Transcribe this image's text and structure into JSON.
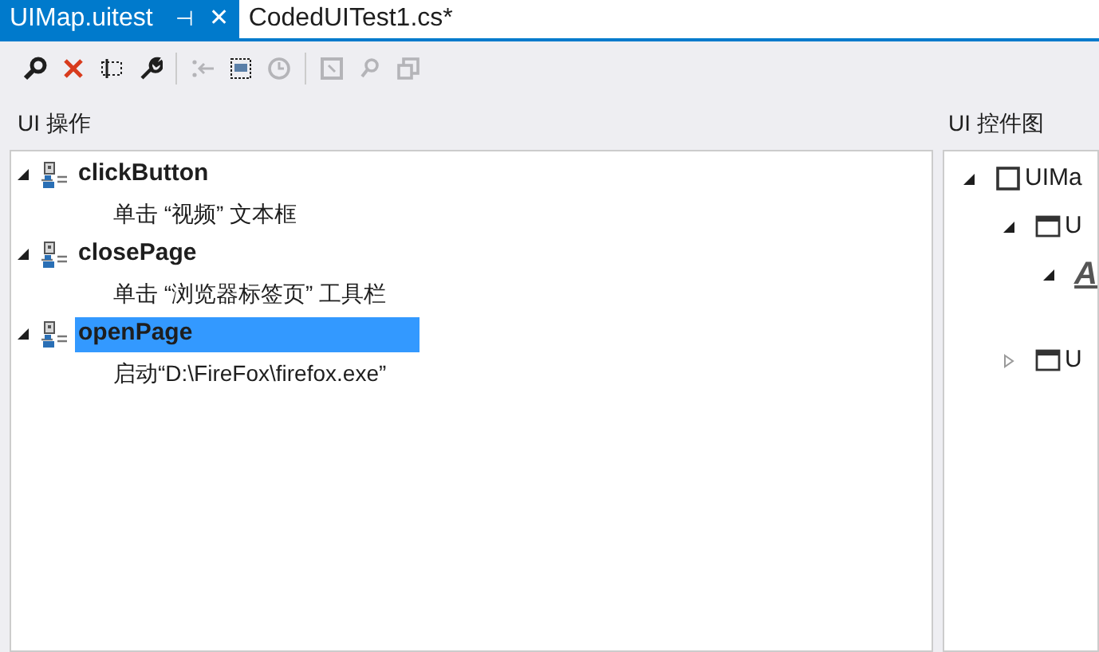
{
  "tabs": [
    {
      "label": "UIMap.uitest",
      "selected": true,
      "pin": "⊣",
      "close": "✕"
    },
    {
      "label": "CodedUITest1.cs*",
      "selected": false
    }
  ],
  "toolbar": [
    {
      "kind": "find",
      "disabled": false
    },
    {
      "kind": "delete",
      "disabled": false
    },
    {
      "kind": "rename",
      "disabled": false
    },
    {
      "kind": "properties",
      "disabled": false
    },
    {
      "kind": "move",
      "disabled": true
    },
    {
      "kind": "split",
      "disabled": false
    },
    {
      "kind": "delay",
      "disabled": true
    },
    {
      "kind": "locate",
      "disabled": true
    },
    {
      "kind": "search",
      "disabled": true
    },
    {
      "kind": "copy",
      "disabled": true
    }
  ],
  "actions_panel": {
    "title": "UI 操作",
    "items": [
      {
        "label": "clickButton",
        "expanded": true,
        "selected": false,
        "children": [
          {
            "label": "单击 “视频” 文本框"
          }
        ]
      },
      {
        "label": "closePage",
        "expanded": true,
        "selected": false,
        "children": [
          {
            "label": "单击 “浏览器标签页” 工具栏"
          }
        ]
      },
      {
        "label": "openPage",
        "expanded": true,
        "selected": true,
        "children": [
          {
            "label": "启动“D:\\FireFox\\firefox.exe”"
          }
        ]
      }
    ]
  },
  "controls_panel": {
    "title": "UI 控件图",
    "items": [
      {
        "label": "UIMa",
        "kind": "map",
        "expanded": true,
        "children": [
          {
            "label": "U",
            "kind": "window",
            "expanded": true,
            "children": [
              {
                "label": "A",
                "kind": "text",
                "expanded": true
              }
            ]
          },
          {
            "label": "U",
            "kind": "window",
            "expanded": false
          }
        ]
      }
    ]
  }
}
